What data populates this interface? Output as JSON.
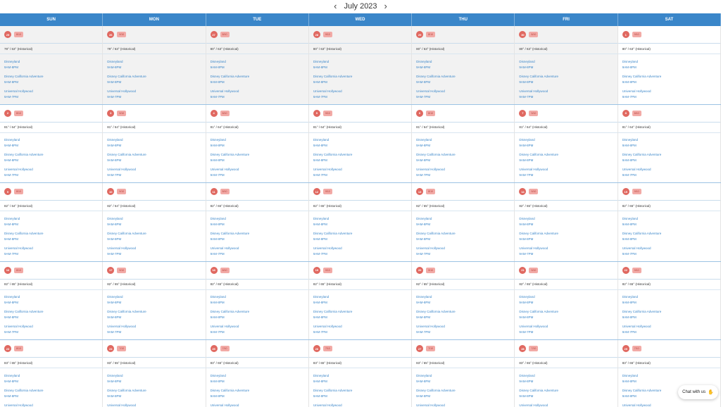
{
  "calendar": {
    "month_title": "July 2023",
    "prev_arrow": "‹",
    "next_arrow": "›",
    "days_of_week": [
      "SUN",
      "MON",
      "TUE",
      "WED",
      "THU",
      "FRI",
      "SAT"
    ],
    "park_names": [
      "Disneyland",
      "Disney California Adventure",
      "Universal Hollywood"
    ],
    "park_hours": [
      "9AM-8PM",
      "9AM-8PM",
      "9AM-7PM"
    ],
    "colors": {
      "header": "#3a86c9",
      "date_circle": "#e06860",
      "badge": "#f2aaa6",
      "link": "#3a86c9"
    },
    "weeks": [
      {
        "dates": [
          "25",
          "26",
          "27",
          "28",
          "29",
          "30",
          "1"
        ],
        "badges": [
          "8/10",
          "9/10",
          "8/10",
          "9/10",
          "8/10",
          "8/10",
          "9/10"
        ],
        "weather": [
          "79° / 63° (Historical)",
          "79° / 63° (Historical)",
          "80° / 63° (Historical)",
          "80° / 63° (Historical)",
          "80° / 63° (Historical)",
          "80° / 63° (Historical)",
          "80° / 63° (Historical)"
        ],
        "past": [
          true,
          true,
          true,
          true,
          true,
          true,
          false
        ]
      },
      {
        "dates": [
          "2",
          "3",
          "4",
          "5",
          "6",
          "7",
          "8"
        ],
        "badges": [
          "8/10",
          "9/10",
          "8/10",
          "9/10",
          "8/10",
          "9/10",
          "8/10"
        ],
        "weather": [
          "81° / 64° (Historical)",
          "81° / 64° (Historical)",
          "81° / 64° (Historical)",
          "81° / 64° (Historical)",
          "81° / 64° (Historical)",
          "81° / 64° (Historical)",
          "81° / 64° (Historical)"
        ],
        "past": [
          false,
          false,
          false,
          false,
          false,
          false,
          false
        ]
      },
      {
        "dates": [
          "9",
          "10",
          "11",
          "12",
          "13",
          "14",
          "15"
        ],
        "badges": [
          "8/10",
          "9/10",
          "8/10",
          "9/10",
          "8/10",
          "9/10",
          "9/10"
        ],
        "weather": [
          "82° / 64° (Historical)",
          "82° / 64° (Historical)",
          "82° / 65° (Historical)",
          "82° / 65° (Historical)",
          "82° / 65° (Historical)",
          "82° / 65° (Historical)",
          "82° / 65° (Historical)"
        ],
        "past": [
          false,
          false,
          false,
          false,
          false,
          false,
          false
        ]
      },
      {
        "dates": [
          "16",
          "17",
          "18",
          "19",
          "20",
          "21",
          "22"
        ],
        "badges": [
          "8/10",
          "9/10",
          "8/10",
          "9/10",
          "9/10",
          "9/10",
          "9/10"
        ],
        "weather": [
          "82° / 65° (Historical)",
          "82° / 65° (Historical)",
          "82° / 65° (Historical)",
          "82° / 65° (Historical)",
          "82° / 65° (Historical)",
          "82° / 65° (Historical)",
          "82° / 65° (Historical)"
        ],
        "past": [
          false,
          false,
          false,
          false,
          false,
          false,
          false
        ]
      },
      {
        "dates": [
          "23",
          "24",
          "25",
          "26",
          "27",
          "28",
          "29"
        ],
        "badges": [
          "8/10",
          "7/10",
          "7/10",
          "7/10",
          "7/10",
          "7/10",
          "7/10"
        ],
        "weather": [
          "83° / 65° (Historical)",
          "83° / 65° (Historical)",
          "83° / 65° (Historical)",
          "83° / 65° (Historical)",
          "83° / 65° (Historical)",
          "83° / 65° (Historical)",
          "83° / 65° (Historical)"
        ],
        "past": [
          false,
          false,
          false,
          false,
          false,
          false,
          false
        ]
      }
    ]
  },
  "chat": {
    "label": "Chat with us",
    "icon": "wave-hand-icon",
    "glyph": "✋"
  }
}
